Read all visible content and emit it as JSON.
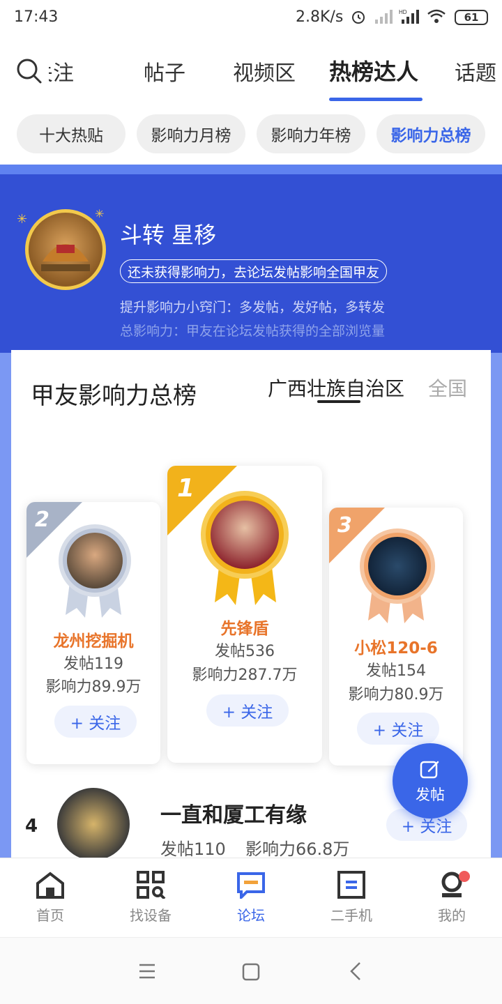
{
  "status_bar": {
    "time": "17:43",
    "net_speed": "2.8K/s",
    "battery": "61"
  },
  "nav_tabs": [
    {
      "label": "关注"
    },
    {
      "label": "帖子"
    },
    {
      "label": "视频区"
    },
    {
      "label": "热榜达人"
    },
    {
      "label": "话题"
    }
  ],
  "sub_tabs": [
    {
      "label": "十大热贴"
    },
    {
      "label": "影响力月榜"
    },
    {
      "label": "影响力年榜"
    },
    {
      "label": "影响力总榜"
    }
  ],
  "hero": {
    "name": "斗转 星移",
    "notice": "还未获得影响力，去论坛发帖影响全国甲友",
    "tip1": "提升影响力小窍门：多发帖，发好帖，多转发",
    "tip2": "总影响力：甲友在论坛发帖获得的全部浏览量"
  },
  "board": {
    "title": "甲友影响力总榜",
    "region_local": "广西壮族自治区",
    "region_all": "全国"
  },
  "podium": [
    {
      "rank": "2",
      "name": "龙州挖掘机",
      "posts": "发帖119",
      "influence": "影响力89.9万",
      "follow": "+ 关注"
    },
    {
      "rank": "1",
      "name": "先锋盾",
      "posts": "发帖536",
      "influence": "影响力287.7万",
      "follow": "+ 关注"
    },
    {
      "rank": "3",
      "name": "小松120-6",
      "posts": "发帖154",
      "influence": "影响力80.9万",
      "follow": "+ 关注"
    }
  ],
  "list": [
    {
      "rank": "4",
      "name": "一直和厦工有缘",
      "posts": "发帖110",
      "influence": "影响力66.8万",
      "follow": "+ 关注"
    }
  ],
  "fab": {
    "label": "发帖"
  },
  "bottom_nav": [
    {
      "label": "首页",
      "icon": "home-icon"
    },
    {
      "label": "找设备",
      "icon": "find-device-icon"
    },
    {
      "label": "论坛",
      "icon": "forum-icon"
    },
    {
      "label": "二手机",
      "icon": "used-machine-icon"
    },
    {
      "label": "我的",
      "icon": "profile-icon"
    }
  ],
  "colors": {
    "accent": "#3a66e8",
    "hero_bg": "#3350d4",
    "gold": "#f2b21b",
    "silver": "#aab4c8",
    "bronze": "#f0a36a",
    "name_orange": "#e8742a"
  }
}
